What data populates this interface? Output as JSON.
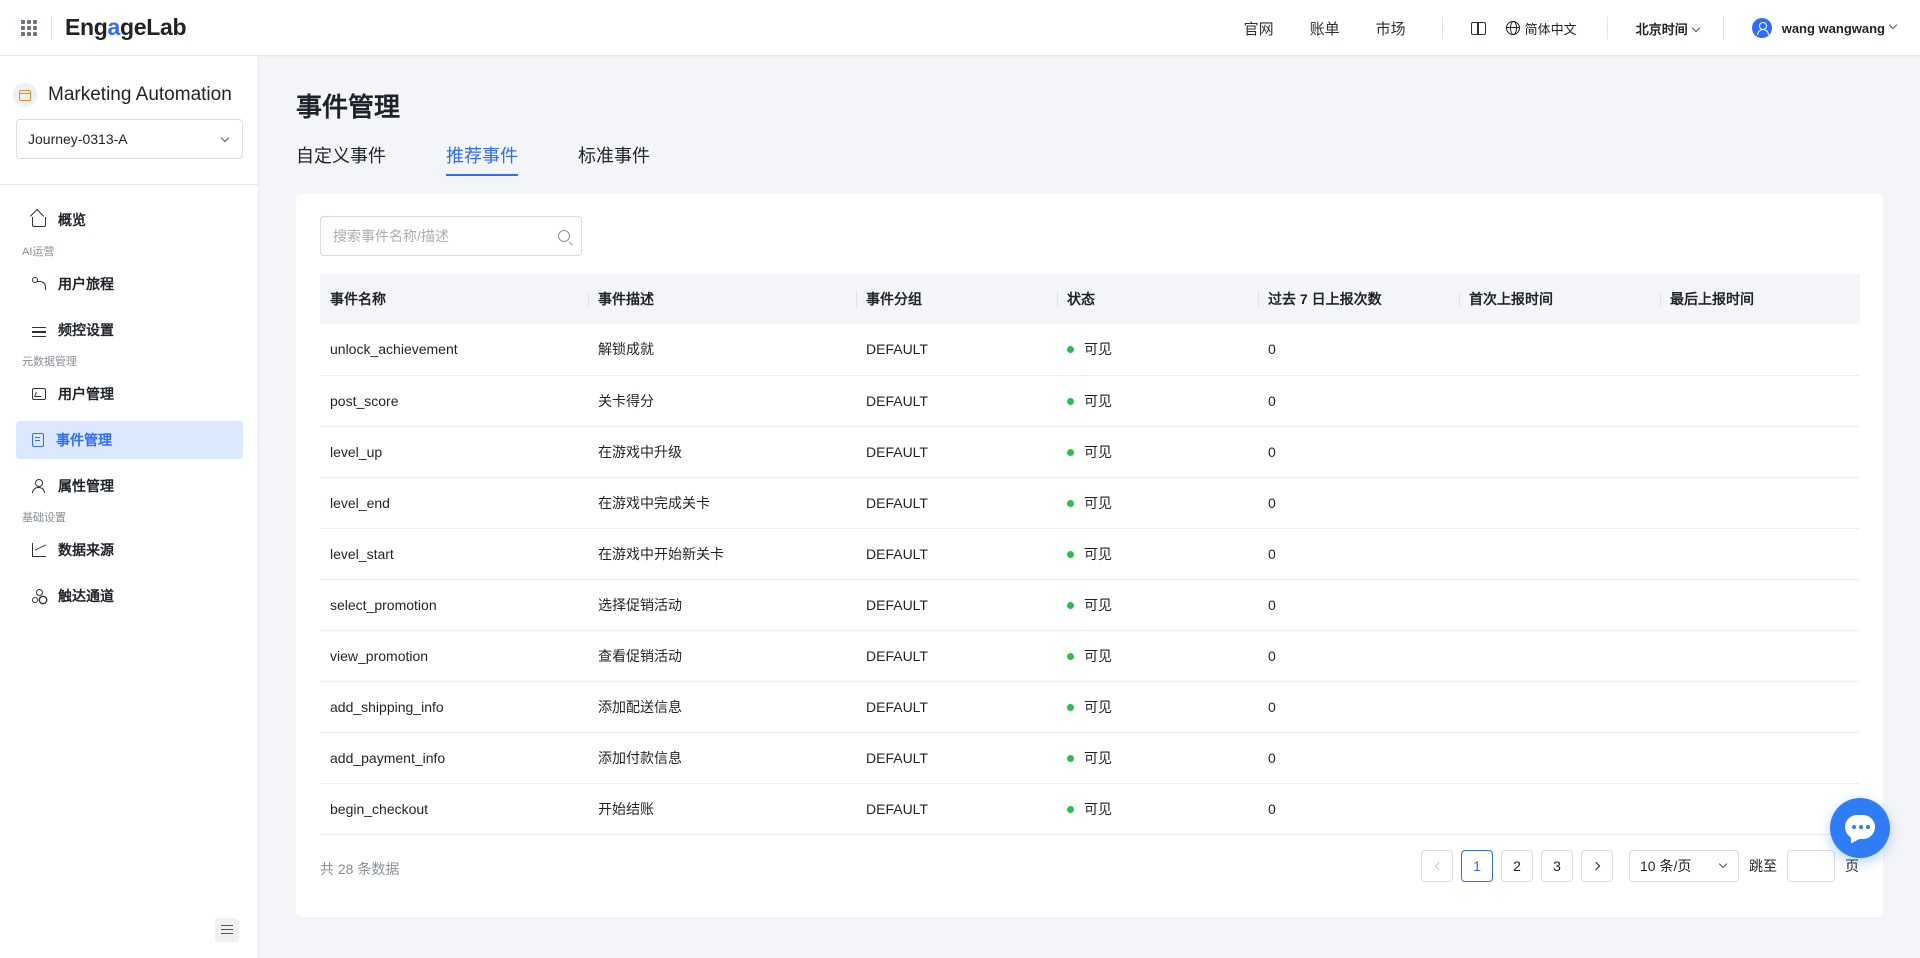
{
  "topbar": {
    "logo": {
      "pre": "Eng",
      "accent": "a",
      "post": "geLab"
    },
    "links": [
      "官网",
      "账单",
      "市场"
    ],
    "language": "简体中文",
    "timezone": "北京时间",
    "user": "wang wangwang"
  },
  "sidebar": {
    "app_name": "Marketing Automation",
    "project": "Journey-0313-A",
    "overview": "概览",
    "group_ai": "AI运营",
    "journey": "用户旅程",
    "frequency": "频控设置",
    "group_meta": "元数据管理",
    "users": "用户管理",
    "events": "事件管理",
    "attributes": "属性管理",
    "group_basic": "基础设置",
    "datasource": "数据来源",
    "channels": "触达通道"
  },
  "main": {
    "title": "事件管理",
    "tabs": [
      "自定义事件",
      "推荐事件",
      "标准事件"
    ],
    "active_tab": "推荐事件",
    "search_placeholder": "搜索事件名称/描述"
  },
  "table": {
    "columns": [
      "事件名称",
      "事件描述",
      "事件分组",
      "状态",
      "过去 7 日上报次数",
      "首次上报时间",
      "最后上报时间"
    ],
    "rows": [
      {
        "name": "unlock_achievement",
        "desc": "解锁成就",
        "group": "DEFAULT",
        "status": "可见",
        "count": "0",
        "first": "",
        "last": ""
      },
      {
        "name": "post_score",
        "desc": "关卡得分",
        "group": "DEFAULT",
        "status": "可见",
        "count": "0",
        "first": "",
        "last": ""
      },
      {
        "name": "level_up",
        "desc": "在游戏中升级",
        "group": "DEFAULT",
        "status": "可见",
        "count": "0",
        "first": "",
        "last": ""
      },
      {
        "name": "level_end",
        "desc": "在游戏中完成关卡",
        "group": "DEFAULT",
        "status": "可见",
        "count": "0",
        "first": "",
        "last": ""
      },
      {
        "name": "level_start",
        "desc": "在游戏中开始新关卡",
        "group": "DEFAULT",
        "status": "可见",
        "count": "0",
        "first": "",
        "last": ""
      },
      {
        "name": "select_promotion",
        "desc": "选择促销活动",
        "group": "DEFAULT",
        "status": "可见",
        "count": "0",
        "first": "",
        "last": ""
      },
      {
        "name": "view_promotion",
        "desc": "查看促销活动",
        "group": "DEFAULT",
        "status": "可见",
        "count": "0",
        "first": "",
        "last": ""
      },
      {
        "name": "add_shipping_info",
        "desc": "添加配送信息",
        "group": "DEFAULT",
        "status": "可见",
        "count": "0",
        "first": "",
        "last": ""
      },
      {
        "name": "add_payment_info",
        "desc": "添加付款信息",
        "group": "DEFAULT",
        "status": "可见",
        "count": "0",
        "first": "",
        "last": ""
      },
      {
        "name": "begin_checkout",
        "desc": "开始结账",
        "group": "DEFAULT",
        "status": "可见",
        "count": "0",
        "first": "",
        "last": ""
      }
    ]
  },
  "pagination": {
    "total": "共 28 条数据",
    "pages": [
      "1",
      "2",
      "3"
    ],
    "current": "1",
    "page_size": "10 条/页",
    "jump_label": "跳至",
    "page_label": "页"
  },
  "colors": {
    "accent": "#2f6bff",
    "status_visible": "#27c24c",
    "active_nav_bg": "#dce8fd"
  }
}
